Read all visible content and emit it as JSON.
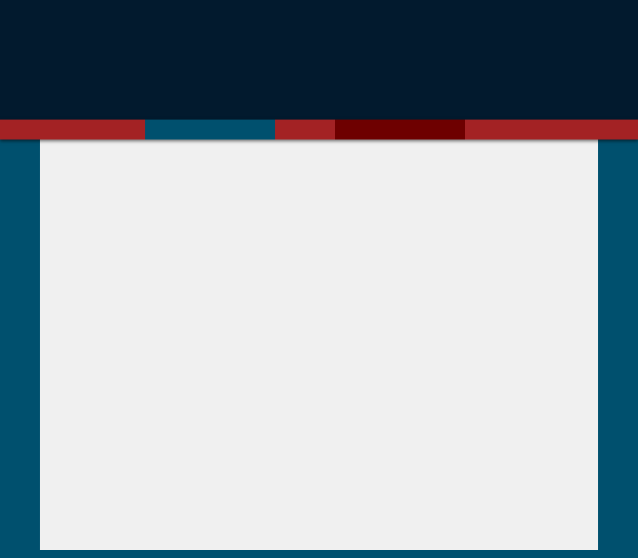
{
  "colors": {
    "header_background": "#021a2e",
    "nav_default": "#a32224",
    "nav_active": "#00506e",
    "nav_hover": "#6e0000",
    "page_background": "#00506e",
    "content_background": "#f0f0f0"
  },
  "nav": {
    "segments": [
      {
        "state": "default",
        "color": "#a32224"
      },
      {
        "state": "active",
        "color": "#00506e"
      },
      {
        "state": "default",
        "color": "#a32224"
      },
      {
        "state": "hover",
        "color": "#6e0000"
      },
      {
        "state": "default",
        "color": "#a32224"
      }
    ]
  }
}
